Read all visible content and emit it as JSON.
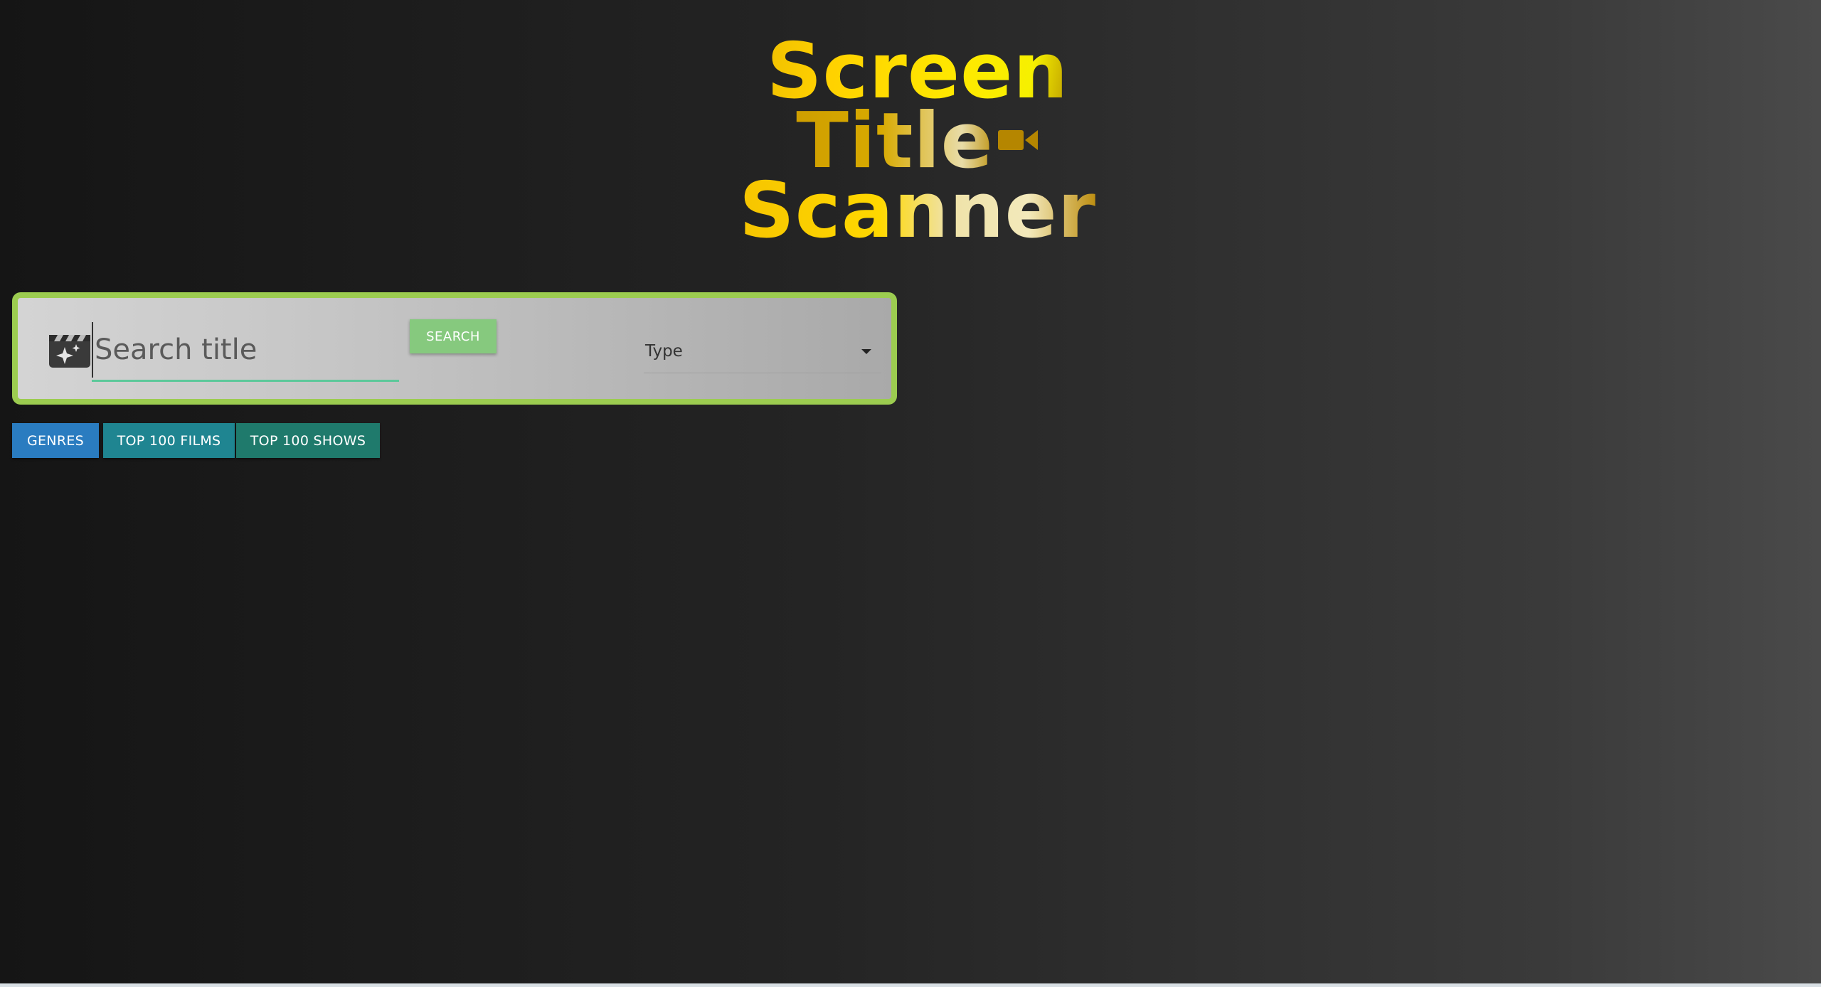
{
  "logo": {
    "line1": "Screen",
    "line2": "Title",
    "line3": "Scanner",
    "icon": "video-camera-icon"
  },
  "search": {
    "icon": "clapperboard-sparkle-icon",
    "placeholder": "Search title",
    "value": "",
    "button_label": "SEARCH",
    "border_color": "#9ccc50",
    "button_color": "#86c97e"
  },
  "type_select": {
    "label": "Type",
    "icon": "dropdown-arrow-icon"
  },
  "nav": {
    "genres_label": "GENRES",
    "top_films_label": "TOP 100 FILMS",
    "top_shows_label": "TOP 100 SHOWS",
    "genres_color": "#2a7cc0",
    "films_color": "#1f8591",
    "shows_color": "#1f7a6c"
  }
}
